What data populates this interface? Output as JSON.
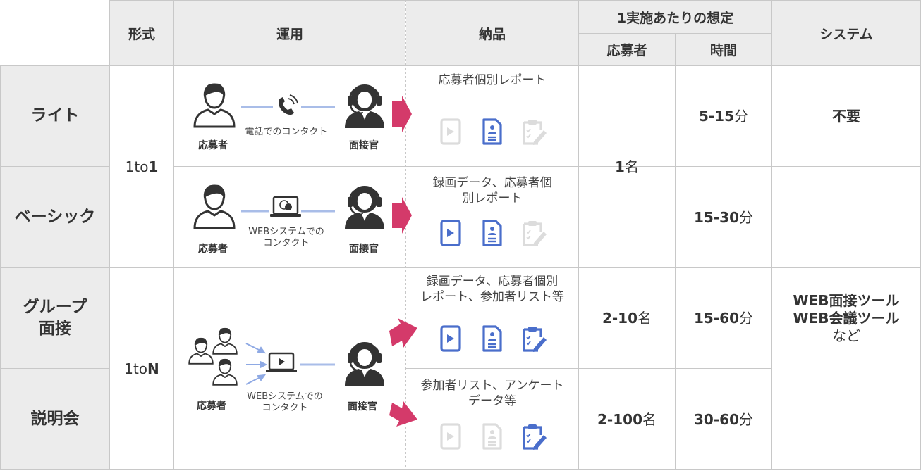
{
  "headers": {
    "format": "形式",
    "operation": "運用",
    "delivery": "納品",
    "per_session": "1実施あたりの想定",
    "applicants": "応募者",
    "time": "時間",
    "system": "システム"
  },
  "rows": [
    {
      "name": "ライト",
      "delivery_text": "応募者個別レポート",
      "contact": "電話でのコンタクト",
      "time_num": "5-15",
      "time_unit": "分",
      "system": "不要"
    },
    {
      "name": "ベーシック",
      "delivery_text_1": "録画データ、応募者個",
      "delivery_text_2": "別レポート",
      "contact_1": "WEBシステムでの",
      "contact_2": "コンタクト",
      "time_num": "15-30",
      "time_unit": "分"
    },
    {
      "name_1": "グループ",
      "name_2": "面接",
      "delivery_text_1": "録画データ、応募者個別",
      "delivery_text_2": "レポート、参加者リスト等",
      "applicants_num": "2-10",
      "applicants_unit": "名",
      "time_num": "15-60",
      "time_unit": "分"
    },
    {
      "name": "説明会",
      "delivery_text_1": "参加者リスト、アンケート",
      "delivery_text_2": "データ等",
      "applicants_num": "2-100",
      "applicants_unit": "名",
      "time_num": "30-60",
      "time_unit": "分"
    }
  ],
  "format_1to1": {
    "prefix": "1to",
    "suffix": "1"
  },
  "format_1toN": {
    "prefix": "1to",
    "suffix": "N"
  },
  "merged_applicants": {
    "num": "1",
    "unit": "名"
  },
  "system_web": {
    "line1": "WEB面接ツール",
    "line2": "WEB会議ツール",
    "line3": "など"
  },
  "roles": {
    "applicant": "応募者",
    "interviewer": "面接官"
  },
  "group_contact": {
    "line1": "WEBシステムでの",
    "line2": "コンタクト"
  },
  "colors": {
    "header_bg": "#ececec",
    "border": "#c8c8c8",
    "accent_blue": "#4a6ecb",
    "arrow_pink": "#d43a6a",
    "line_blue": "#a9bde8",
    "icon_gray": "#dcdcdc"
  }
}
